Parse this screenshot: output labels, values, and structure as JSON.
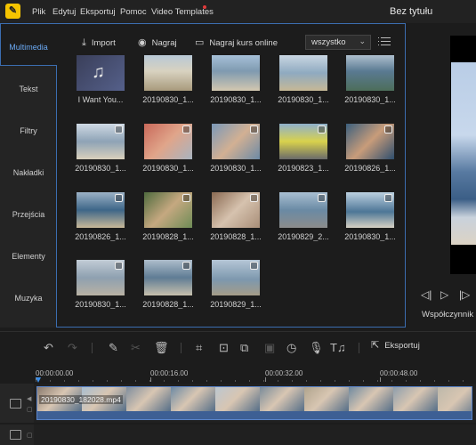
{
  "menubar": {
    "logo_glyph": "✎",
    "items": [
      "Plik",
      "Edytuj",
      "Eksportuj",
      "Pomoc",
      "Video Templates"
    ],
    "title": "Bez tytułu",
    "notification_color": "#e03b3b"
  },
  "sidebar": {
    "items": [
      "Multimedia",
      "Tekst",
      "Filtry",
      "Nakładki",
      "Przejścia",
      "Elementy",
      "Muzyka"
    ],
    "active_index": 0,
    "accent": "#3b6db0"
  },
  "media": {
    "import_label": "Import",
    "record_label": "Nagraj",
    "record_online_label": "Nagraj kurs online",
    "filter_value": "wszystko",
    "items": [
      {
        "caption": "I Want You...",
        "kind": "audio"
      },
      {
        "caption": "20190830_1...",
        "kind": "video"
      },
      {
        "caption": "20190830_1...",
        "kind": "video"
      },
      {
        "caption": "20190830_1...",
        "kind": "video"
      },
      {
        "caption": "20190830_1...",
        "kind": "video"
      },
      {
        "caption": "20190830_1...",
        "kind": "video"
      },
      {
        "caption": "20190830_1...",
        "kind": "video"
      },
      {
        "caption": "20190830_1...",
        "kind": "video"
      },
      {
        "caption": "20190823_1...",
        "kind": "video"
      },
      {
        "caption": "20190826_1...",
        "kind": "video"
      },
      {
        "caption": "20190826_1...",
        "kind": "video"
      },
      {
        "caption": "20190828_1...",
        "kind": "video"
      },
      {
        "caption": "20190828_1...",
        "kind": "video"
      },
      {
        "caption": "20190829_2...",
        "kind": "video"
      },
      {
        "caption": "20190830_1...",
        "kind": "video"
      },
      {
        "caption": "20190830_1...",
        "kind": "video"
      },
      {
        "caption": "20190828_1...",
        "kind": "video"
      },
      {
        "caption": "20190829_1...",
        "kind": "video"
      }
    ]
  },
  "preview": {
    "ratio_label": "Współczynnik k"
  },
  "toolbar": {
    "export_label": "Eksportuj"
  },
  "timeline": {
    "ticks": [
      "00:00:00.00",
      "00:00:16.00",
      "00:00:32.00",
      "00:00:48.00"
    ],
    "clip_name": "20190830_182028.mp4",
    "playhead_color": "#3b8de6"
  }
}
